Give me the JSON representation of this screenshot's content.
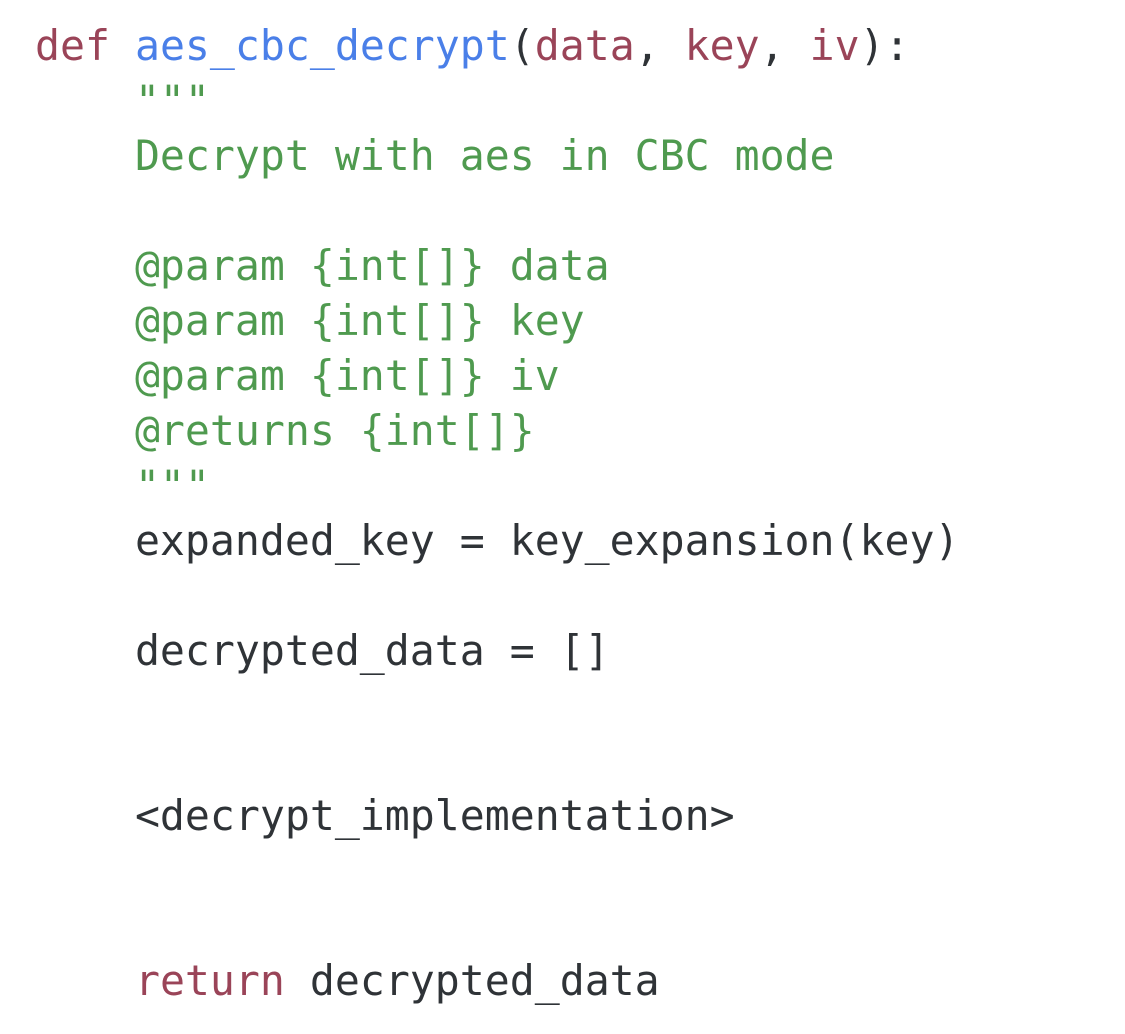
{
  "colors": {
    "keyword": "#9a4458",
    "function": "#4a7fe8",
    "docstring": "#4f9a4f",
    "text": "#2f3337",
    "background": "#ffffff"
  },
  "lines": [
    {
      "tokens": [
        {
          "text": "def ",
          "kind": "kw"
        },
        {
          "text": "aes_cbc_decrypt",
          "kind": "fn"
        },
        {
          "text": "(",
          "kind": "plain"
        },
        {
          "text": "data",
          "kind": "param"
        },
        {
          "text": ", ",
          "kind": "plain"
        },
        {
          "text": "key",
          "kind": "param"
        },
        {
          "text": ", ",
          "kind": "plain"
        },
        {
          "text": "iv",
          "kind": "param"
        },
        {
          "text": "):",
          "kind": "plain"
        }
      ]
    },
    {
      "tokens": [
        {
          "text": "    \"\"\"",
          "kind": "doc"
        }
      ]
    },
    {
      "tokens": [
        {
          "text": "    Decrypt with aes in CBC mode",
          "kind": "doc"
        }
      ]
    },
    {
      "tokens": []
    },
    {
      "tokens": [
        {
          "text": "    @param {int[]} data",
          "kind": "doc"
        }
      ]
    },
    {
      "tokens": [
        {
          "text": "    @param {int[]} key",
          "kind": "doc"
        }
      ]
    },
    {
      "tokens": [
        {
          "text": "    @param {int[]} iv",
          "kind": "doc"
        }
      ]
    },
    {
      "tokens": [
        {
          "text": "    @returns {int[]}",
          "kind": "doc"
        }
      ]
    },
    {
      "tokens": [
        {
          "text": "    \"\"\"",
          "kind": "doc"
        }
      ]
    },
    {
      "tokens": [
        {
          "text": "    expanded_key = key_expansion(key)",
          "kind": "plain"
        }
      ]
    },
    {
      "tokens": []
    },
    {
      "tokens": [
        {
          "text": "    decrypted_data = []",
          "kind": "plain"
        }
      ]
    },
    {
      "tokens": []
    },
    {
      "tokens": []
    },
    {
      "tokens": [
        {
          "text": "    <decrypt_implementation>",
          "kind": "plain"
        }
      ]
    },
    {
      "tokens": []
    },
    {
      "tokens": []
    },
    {
      "tokens": [
        {
          "text": "    ",
          "kind": "plain"
        },
        {
          "text": "return",
          "kind": "kw"
        },
        {
          "text": " decrypted_data",
          "kind": "plain"
        }
      ]
    }
  ]
}
